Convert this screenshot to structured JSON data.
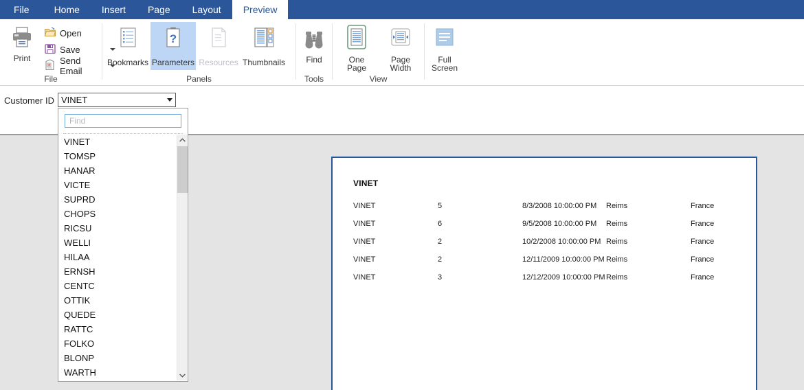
{
  "window": {
    "tabs": [
      {
        "label": "File",
        "active": false
      },
      {
        "label": "Home",
        "active": false
      },
      {
        "label": "Insert",
        "active": false
      },
      {
        "label": "Page",
        "active": false
      },
      {
        "label": "Layout",
        "active": false
      },
      {
        "label": "Preview",
        "active": true
      }
    ]
  },
  "ribbon": {
    "groups": [
      {
        "name": "File",
        "label": "File"
      },
      {
        "name": "Panels",
        "label": "Panels"
      },
      {
        "name": "Tools",
        "label": "Tools"
      },
      {
        "name": "View",
        "label": "View"
      }
    ],
    "file_group": {
      "print": {
        "label": "Print",
        "icon": "printer-icon"
      },
      "open": {
        "label": "Open",
        "icon": "folder-open-icon"
      },
      "save": {
        "label": "Save",
        "icon": "floppy-disk-icon",
        "has_dropdown": true
      },
      "send_email": {
        "label": "Send Email",
        "icon": "envelope-icon",
        "has_dropdown": true
      }
    },
    "panels_group": {
      "bookmarks": {
        "label": "Bookmarks",
        "icon": "bookmarks-list-icon",
        "selected": false,
        "disabled": false
      },
      "parameters": {
        "label": "Parameters",
        "icon": "clipboard-question-icon",
        "selected": true,
        "disabled": false
      },
      "resources": {
        "label": "Resources",
        "icon": "document-page-icon",
        "selected": false,
        "disabled": true
      },
      "thumbnails": {
        "label": "Thumbnails",
        "icon": "thumbnails-grid-icon",
        "selected": false,
        "disabled": false
      }
    },
    "tools_group": {
      "find": {
        "label": "Find",
        "icon": "binoculars-icon"
      }
    },
    "view_group": {
      "one_page": {
        "label": "One\nPage",
        "line1": "One",
        "line2": "Page",
        "icon": "one-page-icon",
        "selected": true
      },
      "page_width": {
        "label": "Page Width",
        "line1": "Page",
        "line2": "Width",
        "icon": "page-width-icon",
        "selected": false
      },
      "full_screen": {
        "label": "Full Screen",
        "line1": "Full",
        "line2": "Screen",
        "icon": "full-screen-icon",
        "selected": false
      }
    }
  },
  "parameters_panel": {
    "customer_id": {
      "label": "Customer ID",
      "value": "VINET"
    }
  },
  "dropdown": {
    "open": true,
    "find": {
      "value": "",
      "placeholder": "Find"
    },
    "options": [
      "VINET",
      "TOMSP",
      "HANAR",
      "VICTE",
      "SUPRD",
      "CHOPS",
      "RICSU",
      "WELLI",
      "HILAA",
      "ERNSH",
      "CENTC",
      "OTTIK",
      "QUEDE",
      "RATTC",
      "FOLKO",
      "BLONP",
      "WARTH"
    ],
    "scrollbar": {
      "up_arrow": "⌃",
      "down_arrow": "⌄"
    }
  },
  "report": {
    "title": "VINET",
    "rows": [
      {
        "customer": "VINET",
        "qty": "5",
        "date": "8/3/2008 10:00:00 PM",
        "city": "Reims",
        "country": "France"
      },
      {
        "customer": "VINET",
        "qty": "6",
        "date": "9/5/2008 10:00:00 PM",
        "city": "Reims",
        "country": "France"
      },
      {
        "customer": "VINET",
        "qty": "2",
        "date": "10/2/2008 10:00:00 PM",
        "city": "Reims",
        "country": "France"
      },
      {
        "customer": "VINET",
        "qty": "2",
        "date": "12/11/2009 10:00:00 PM",
        "city": "Reims",
        "country": "France"
      },
      {
        "customer": "VINET",
        "qty": "3",
        "date": "12/12/2009 10:00:00 PM",
        "city": "Reims",
        "country": "France"
      }
    ]
  },
  "colors": {
    "ribbon_blue": "#2b579a",
    "selected_panel": "#bdd6f5",
    "preview_background": "#e4e4e4",
    "page_border": "#2b579a",
    "disabled_text": "#bfc0cc"
  }
}
